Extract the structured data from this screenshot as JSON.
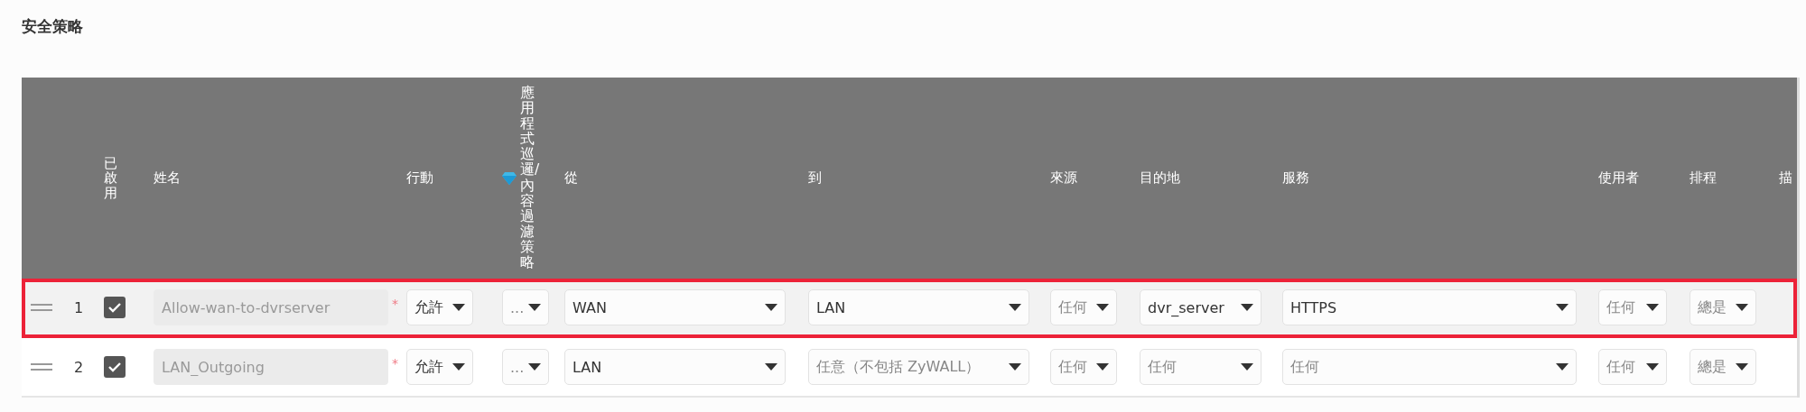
{
  "section_title": "安全策略",
  "table": {
    "columns": [
      {
        "label": "已啟用",
        "kind": "vertical"
      },
      {
        "label": "姓名",
        "kind": "text"
      },
      {
        "label": "行動",
        "kind": "text"
      },
      {
        "label": "應用程式巡邏/內容過濾策略",
        "kind": "vertical_icon"
      },
      {
        "label": "從",
        "kind": "text"
      },
      {
        "label": "到",
        "kind": "text"
      },
      {
        "label": "來源",
        "kind": "text"
      },
      {
        "label": "目的地",
        "kind": "text"
      },
      {
        "label": "服務",
        "kind": "text"
      },
      {
        "label": "使用者",
        "kind": "text"
      },
      {
        "label": "排程",
        "kind": "text"
      },
      {
        "label": "描",
        "kind": "text"
      }
    ],
    "rows": [
      {
        "selected": true,
        "index": "1",
        "cells": [
          {
            "kind": "checkbox",
            "checked": true
          },
          {
            "kind": "field",
            "value": "Allow-wan-to-dvrserver",
            "disabled": true,
            "required_mark": "*"
          },
          {
            "kind": "dropdown",
            "value": "允許",
            "dimmed": false
          },
          {
            "kind": "dropdown",
            "value": "...",
            "dimmed": true
          },
          {
            "kind": "dropdown",
            "value": "WAN",
            "dimmed": false
          },
          {
            "kind": "dropdown",
            "value": "LAN",
            "dimmed": false
          },
          {
            "kind": "dropdown",
            "value": "任何",
            "dimmed": true
          },
          {
            "kind": "dropdown",
            "value": "dvr_server",
            "dimmed": false
          },
          {
            "kind": "dropdown",
            "value": "HTTPS",
            "dimmed": false
          },
          {
            "kind": "dropdown",
            "value": "任何",
            "dimmed": true
          },
          {
            "kind": "dropdown",
            "value": "總是",
            "dimmed": true
          }
        ]
      },
      {
        "selected": false,
        "index": "2",
        "cells": [
          {
            "kind": "checkbox",
            "checked": true
          },
          {
            "kind": "field",
            "value": "LAN_Outgoing",
            "disabled": true,
            "required_mark": "*"
          },
          {
            "kind": "dropdown",
            "value": "允許",
            "dimmed": false
          },
          {
            "kind": "dropdown",
            "value": "...",
            "dimmed": true
          },
          {
            "kind": "dropdown",
            "value": "LAN",
            "dimmed": false
          },
          {
            "kind": "dropdown",
            "value": "任意（不包括 ZyWALL）",
            "dimmed": true
          },
          {
            "kind": "dropdown",
            "value": "任何",
            "dimmed": true
          },
          {
            "kind": "dropdown",
            "value": "任何",
            "dimmed": true
          },
          {
            "kind": "dropdown",
            "value": "任何",
            "dimmed": true
          },
          {
            "kind": "dropdown",
            "value": "任何",
            "dimmed": true
          },
          {
            "kind": "dropdown",
            "value": "總是",
            "dimmed": true
          }
        ]
      }
    ]
  }
}
